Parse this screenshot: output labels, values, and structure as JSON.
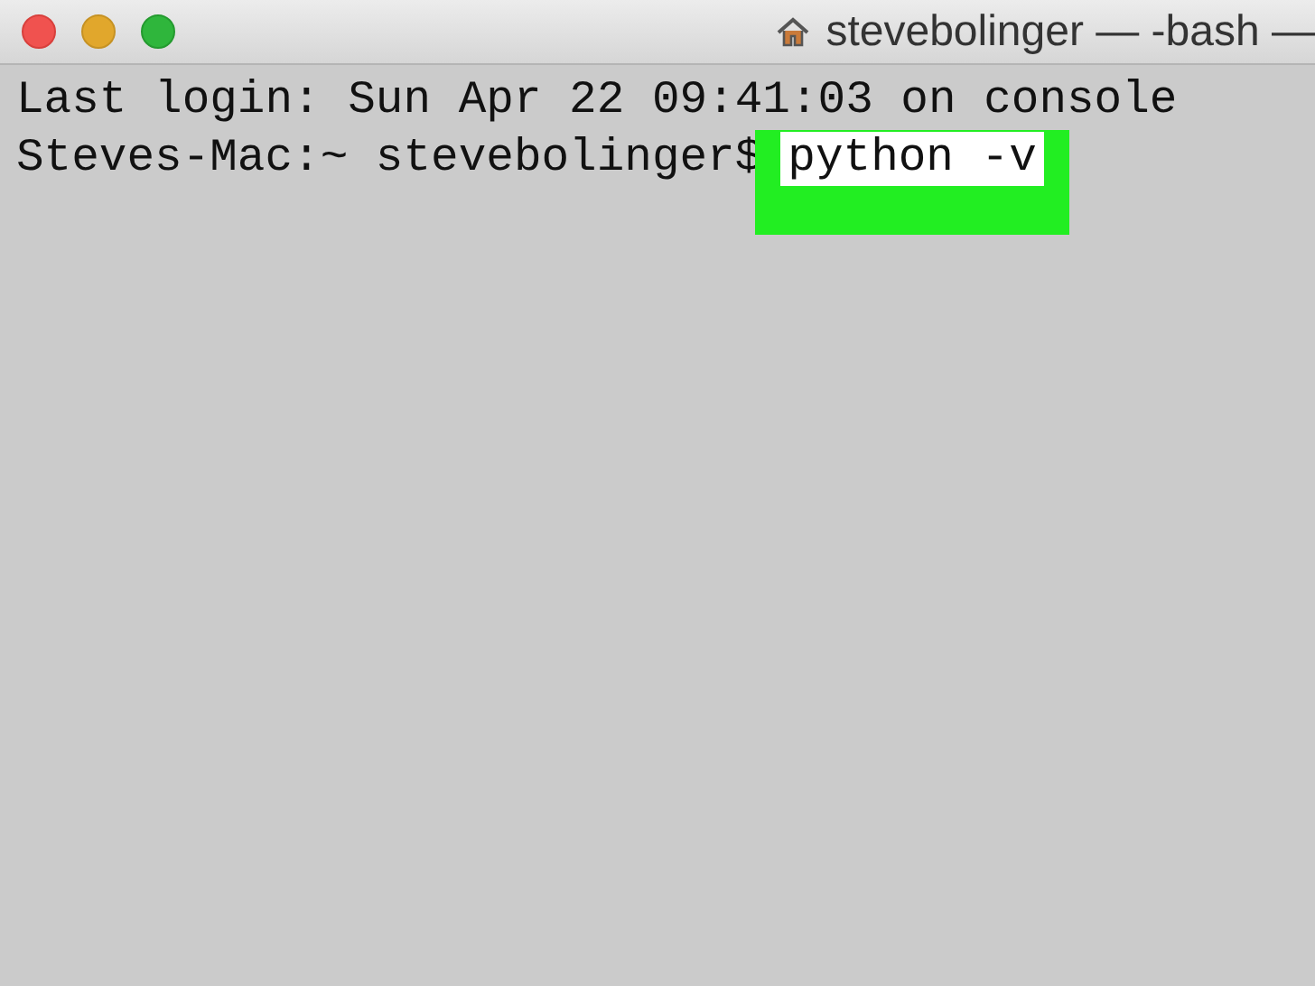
{
  "window": {
    "title": "stevebolinger — -bash —"
  },
  "lines": [
    {
      "kind": "output",
      "text": "Last login: Sun Apr 22 09:41:03 on console"
    },
    {
      "kind": "prompt",
      "prompt": "Steves-Mac:~ stevebolinger$",
      "command": "python -v",
      "highlighted": true
    }
  ]
}
